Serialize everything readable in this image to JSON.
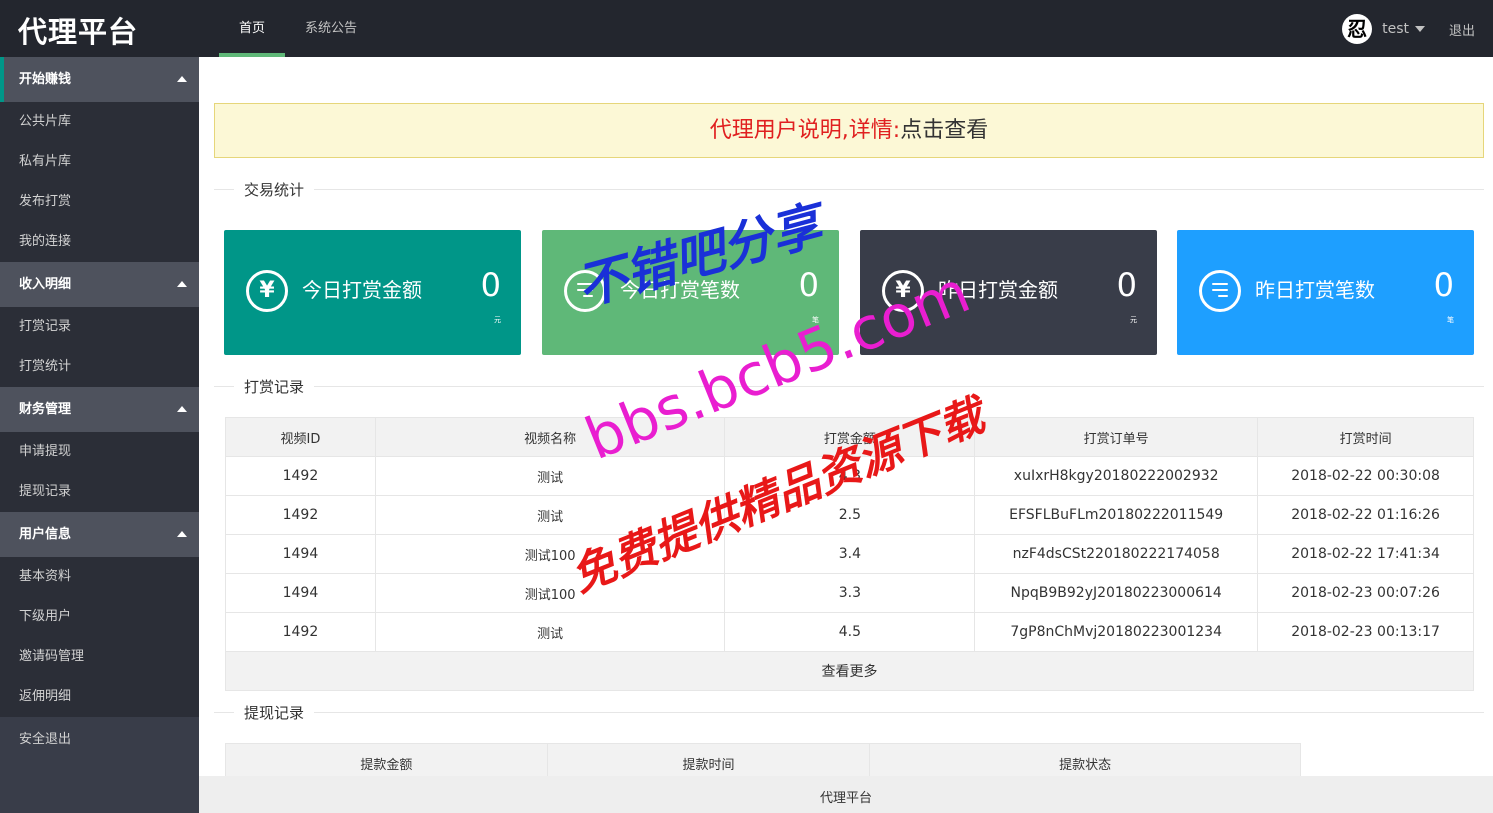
{
  "header": {
    "logo": "代理平台",
    "nav": [
      {
        "label": "首页",
        "active": true
      },
      {
        "label": "系统公告",
        "active": false
      }
    ],
    "user": {
      "avatar_glyph": "忍",
      "name": "test"
    },
    "logout": "退出"
  },
  "sidebar": {
    "groups": [
      {
        "title": "开始赚钱",
        "items": [
          "公共片库",
          "私有片库",
          "发布打赏",
          "我的连接"
        ]
      },
      {
        "title": "收入明细",
        "items": [
          "打赏记录",
          "打赏统计"
        ]
      },
      {
        "title": "财务管理",
        "items": [
          "申请提现",
          "提现记录"
        ]
      },
      {
        "title": "用户信息",
        "items": [
          "基本资料",
          "下级用户",
          "邀请码管理",
          "返佣明细"
        ]
      }
    ],
    "exit": "安全退出"
  },
  "notice": {
    "red": "代理用户说明,详情:",
    "link": "点击查看"
  },
  "sections": {
    "stats": "交易统计",
    "records": "打赏记录",
    "withdrawals": "提现记录"
  },
  "cards": [
    {
      "label": "今日打赏金额",
      "value": "0",
      "unit": "元",
      "icon": "yuan-icon",
      "color": "#009688"
    },
    {
      "label": "今日打赏笔数",
      "value": "0",
      "unit": "笔",
      "icon": "list-icon",
      "color": "#5fb878"
    },
    {
      "label": "昨日打赏金额",
      "value": "0",
      "unit": "元",
      "icon": "yuan-icon",
      "color": "#393d49"
    },
    {
      "label": "昨日打赏笔数",
      "value": "0",
      "unit": "笔",
      "icon": "list-icon",
      "color": "#1e9fff"
    }
  ],
  "records_table": {
    "headers": [
      "视频ID",
      "视频名称",
      "打赏金额",
      "打赏订单号",
      "打赏时间"
    ],
    "rows": [
      [
        "1492",
        "测试",
        "4.3",
        "xuIxrH8kgy20180222002932",
        "2018-02-22 00:30:08"
      ],
      [
        "1492",
        "测试",
        "2.5",
        "EFSFLBuFLm20180222011549",
        "2018-02-22 01:16:26"
      ],
      [
        "1494",
        "测试100",
        "3.4",
        "nzF4dsCSt220180222174058",
        "2018-02-22 17:41:34"
      ],
      [
        "1494",
        "测试100",
        "3.3",
        "NpqB9B92yJ20180223000614",
        "2018-02-23 00:07:26"
      ],
      [
        "1492",
        "测试",
        "4.5",
        "7gP8nChMvj20180223001234",
        "2018-02-23 00:13:17"
      ]
    ],
    "more": "查看更多"
  },
  "withdraw_table": {
    "headers": [
      "提款金额",
      "提款时间",
      "提款状态"
    ]
  },
  "footer": "代理平台",
  "watermarks": [
    "不错吧分享",
    "bbs.bcb5.com",
    "免费提供精品资源下载"
  ],
  "colors": {
    "header_bg": "#23262e",
    "sidebar_bg": "#393d49",
    "accent": "#5fb878",
    "notice_red": "#e02020"
  }
}
